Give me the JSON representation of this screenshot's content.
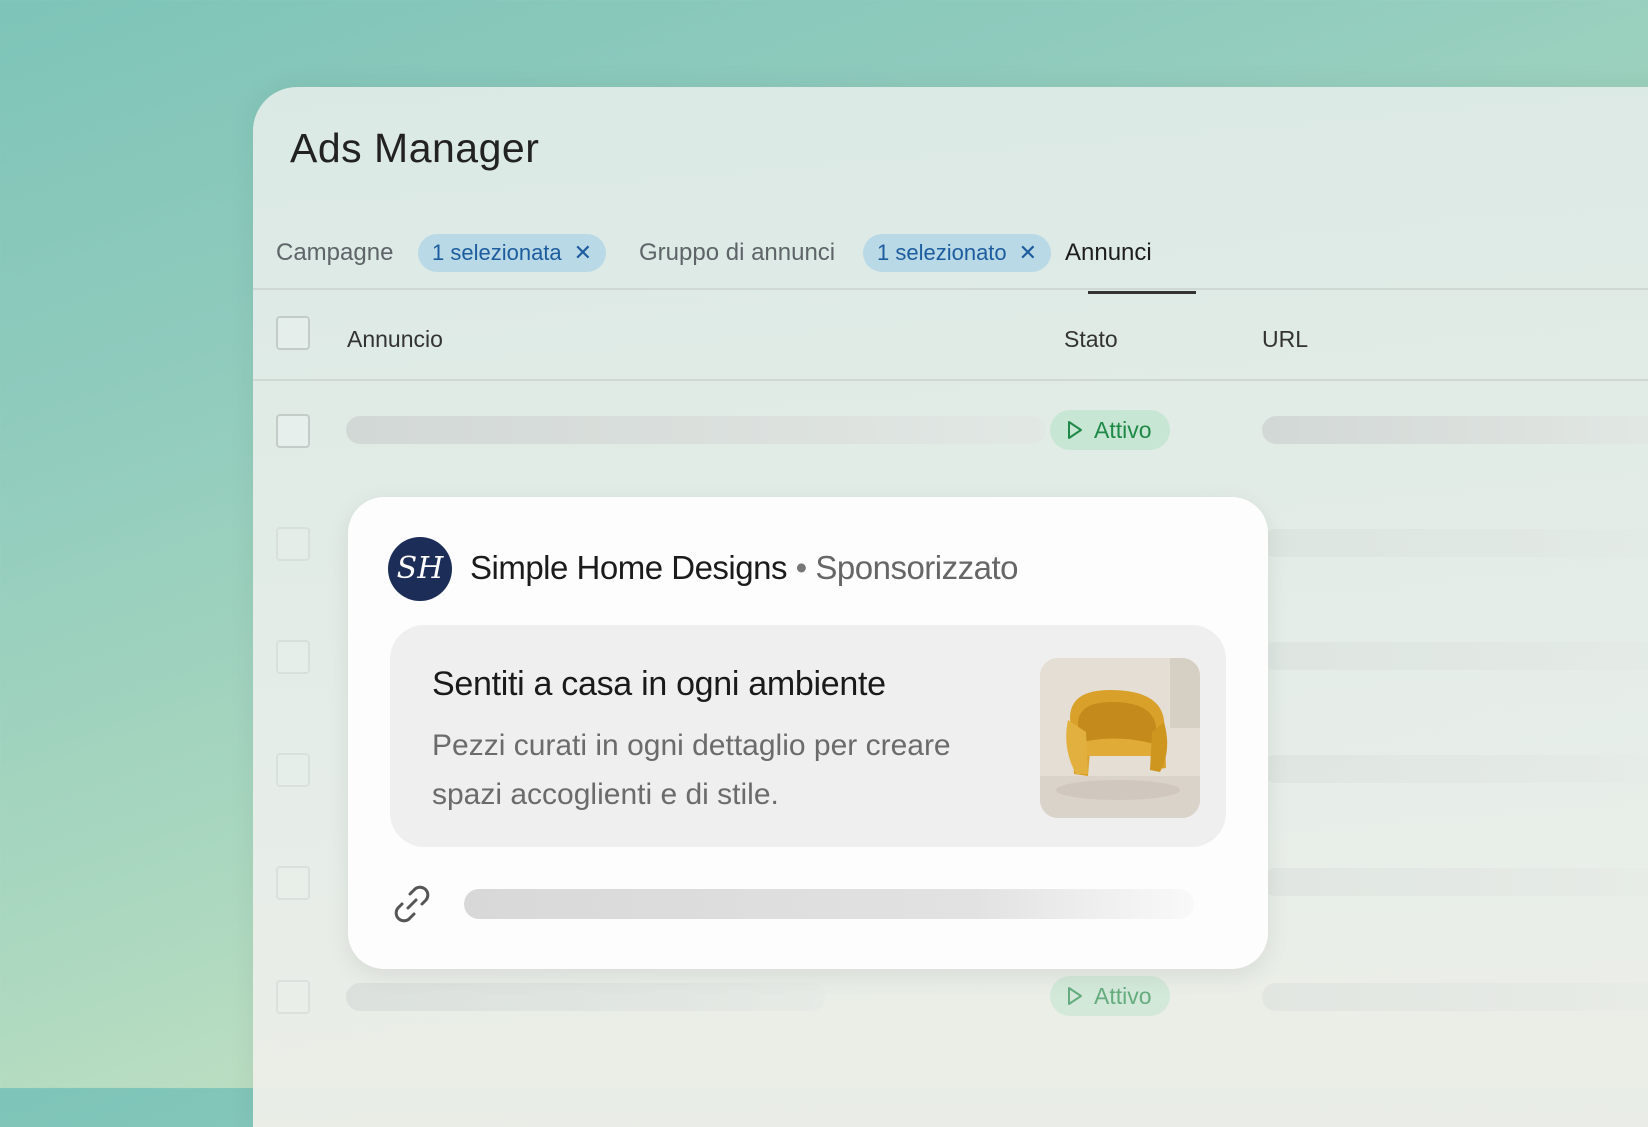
{
  "app": {
    "title": "Ads Manager"
  },
  "tabs": {
    "campaigns": "Campagne",
    "campaigns_chip": "1 selezionata",
    "adsets": "Gruppo di annunci",
    "adsets_chip": "1 selezionato",
    "ads": "Annunci"
  },
  "table": {
    "columns": {
      "ad": "Annuncio",
      "status": "Stato",
      "url": "URL"
    },
    "rows": [
      {
        "status": "Attivo"
      },
      {
        "status": "Attivo"
      }
    ]
  },
  "ad_preview": {
    "brand_initials": "SH",
    "brand_name": "Simple Home Designs",
    "separator": "•",
    "sponsored": "Sponsorizzato",
    "headline": "Sentiti a casa in ogni ambiente",
    "body": "Pezzi curati in ogni dettaglio per creare spazi accoglienti e di stile."
  },
  "colors": {
    "accent_chip_bg": "#b9d9e6",
    "accent_chip_text": "#1d5c9e",
    "status_active_bg": "#c7e6d3",
    "status_active_text": "#1f8a47",
    "brand_logo_bg": "#1c2d58"
  },
  "icons": {
    "chip_close": "close-icon",
    "status": "play-icon",
    "link": "link-icon"
  }
}
